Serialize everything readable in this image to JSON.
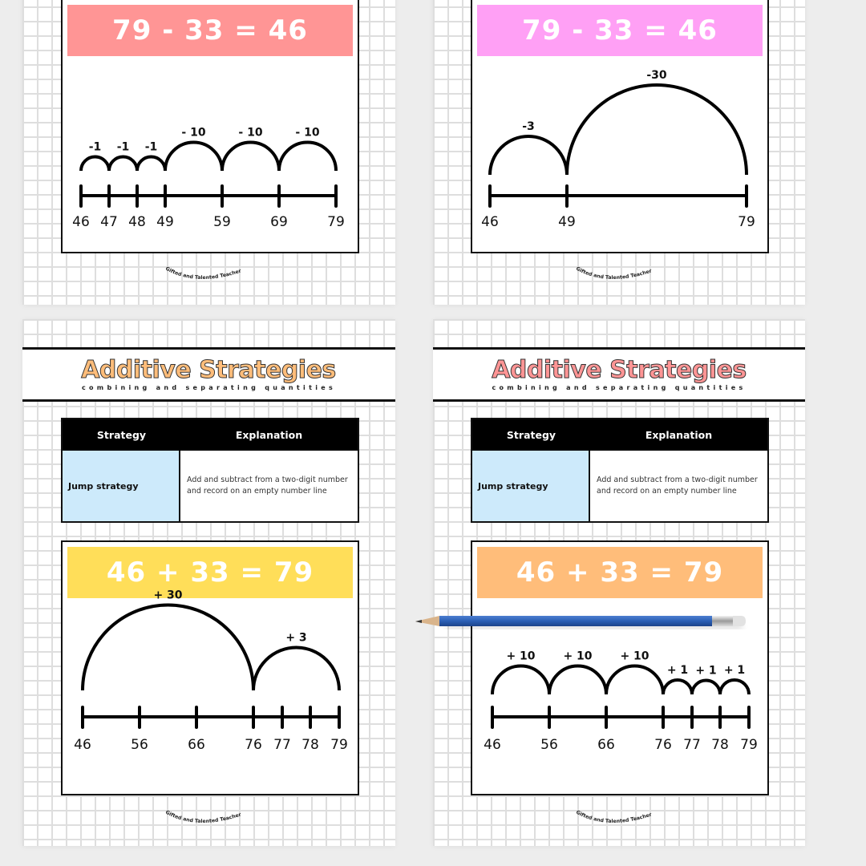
{
  "colors": {
    "background": "#ededed",
    "grid_line": "#dedede",
    "eq_coral": "#ff9595",
    "eq_pink": "#ffa0f5",
    "eq_yellow": "#ffde59",
    "eq_orange": "#ffbd7a",
    "title_orange": "#ffbd7a",
    "title_coral": "#ff9595",
    "strategy_cell": "#cdeafb",
    "pencil_blue": "#2b5fb5"
  },
  "pages": [
    {
      "id": "top-left",
      "equation": "79 - 33 = 46",
      "accent": "#ff9595",
      "number_line": {
        "ticks": [
          {
            "value": 46,
            "label": "46"
          },
          {
            "value": 47,
            "label": "47"
          },
          {
            "value": 48,
            "label": "48"
          },
          {
            "value": 49,
            "label": "49"
          },
          {
            "value": 59,
            "label": "59"
          },
          {
            "value": 69,
            "label": "69"
          },
          {
            "value": 79,
            "label": "79"
          }
        ],
        "jumps": [
          {
            "from": 46,
            "to": 47,
            "label": "-1"
          },
          {
            "from": 47,
            "to": 48,
            "label": "-1"
          },
          {
            "from": 48,
            "to": 49,
            "label": "-1"
          },
          {
            "from": 49,
            "to": 59,
            "label": "- 10"
          },
          {
            "from": 59,
            "to": 69,
            "label": "- 10"
          },
          {
            "from": 69,
            "to": 79,
            "label": "- 10"
          }
        ]
      },
      "logo": "Gifted and Talented Teacher"
    },
    {
      "id": "top-right",
      "equation": "79 - 33 = 46",
      "accent": "#ffa0f5",
      "number_line": {
        "ticks": [
          {
            "value": 46,
            "label": "46"
          },
          {
            "value": 49,
            "label": "49"
          },
          {
            "value": 79,
            "label": "79"
          }
        ],
        "jumps": [
          {
            "from": 46,
            "to": 49,
            "label": "-3"
          },
          {
            "from": 49,
            "to": 79,
            "label": "-30"
          }
        ]
      },
      "logo": "Gifted and Talented Teacher"
    },
    {
      "id": "bottom-left",
      "title": "Additive Strategies",
      "subtitle": "combining and separating quantities",
      "title_color": "#ffbd7a",
      "table": {
        "headers": [
          "Strategy",
          "Explanation"
        ],
        "rows": [
          {
            "strategy": "Jump strategy",
            "explanation": "Add and subtract from a two-digit number and record on an empty number line"
          }
        ]
      },
      "equation": "46 + 33 = 79",
      "accent": "#ffde59",
      "number_line": {
        "ticks": [
          {
            "value": 46,
            "label": "46"
          },
          {
            "value": 56,
            "label": "56"
          },
          {
            "value": 66,
            "label": "66"
          },
          {
            "value": 76,
            "label": "76"
          },
          {
            "value": 77,
            "label": "77"
          },
          {
            "value": 78,
            "label": "78"
          },
          {
            "value": 79,
            "label": "79"
          }
        ],
        "jumps": [
          {
            "from": 46,
            "to": 76,
            "label": "+ 30"
          },
          {
            "from": 76,
            "to": 79,
            "label": "+ 3"
          }
        ]
      },
      "logo": "Gifted and Talented Teacher"
    },
    {
      "id": "bottom-right",
      "title": "Additive Strategies",
      "subtitle": "combining and separating quantities",
      "title_color": "#ff9595",
      "table": {
        "headers": [
          "Strategy",
          "Explanation"
        ],
        "rows": [
          {
            "strategy": "Jump strategy",
            "explanation": "Add and subtract from a two-digit number and record on an empty number line"
          }
        ]
      },
      "equation": "46 + 33 = 79",
      "accent": "#ffbd7a",
      "number_line": {
        "ticks": [
          {
            "value": 46,
            "label": "46"
          },
          {
            "value": 56,
            "label": "56"
          },
          {
            "value": 66,
            "label": "66"
          },
          {
            "value": 76,
            "label": "76"
          },
          {
            "value": 77,
            "label": "77"
          },
          {
            "value": 78,
            "label": "78"
          },
          {
            "value": 79,
            "label": "79"
          }
        ],
        "jumps": [
          {
            "from": 46,
            "to": 56,
            "label": "+ 10"
          },
          {
            "from": 56,
            "to": 66,
            "label": "+ 10"
          },
          {
            "from": 66,
            "to": 76,
            "label": "+ 10"
          },
          {
            "from": 76,
            "to": 77,
            "label": "+ 1"
          },
          {
            "from": 77,
            "to": 78,
            "label": "+ 1"
          },
          {
            "from": 78,
            "to": 79,
            "label": "+ 1"
          }
        ]
      },
      "logo": "Gifted and Talented Teacher"
    }
  ],
  "props": {
    "pencil": "pencil-icon"
  }
}
